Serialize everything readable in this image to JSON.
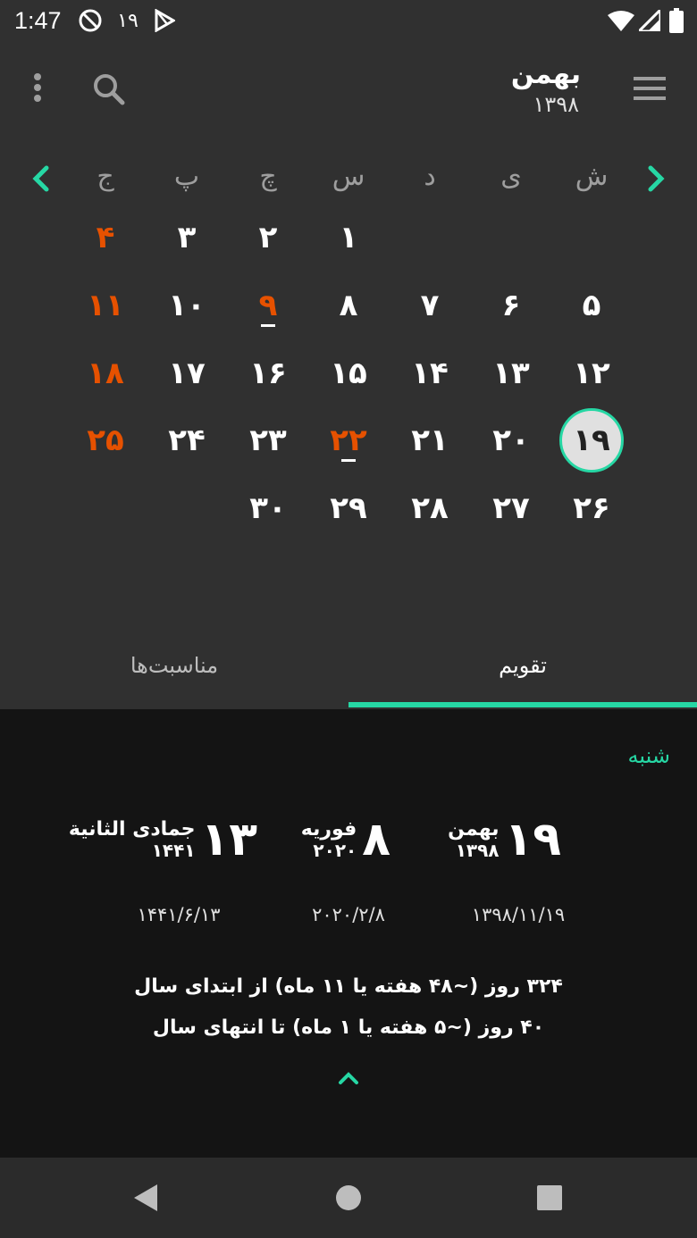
{
  "status_bar": {
    "time": "1:47",
    "day_badge": "۱۹",
    "icons": [
      "do-not-disturb-icon",
      "play-store-icon",
      "wifi-icon",
      "signal-icon",
      "battery-icon"
    ]
  },
  "app_bar": {
    "month": "بهمن",
    "year": "۱۳۹۸",
    "icons": [
      "menu-icon",
      "search-icon",
      "more-vert-icon"
    ]
  },
  "calendar": {
    "weekdays": [
      "ش",
      "ی",
      "د",
      "س",
      "چ",
      "پ",
      "ج"
    ],
    "weeks": [
      [
        "",
        "",
        "",
        "۱",
        "۲",
        "۳",
        "۴"
      ],
      [
        "۵",
        "۶",
        "۷",
        "۸",
        "۹",
        "۱۰",
        "۱۱"
      ],
      [
        "۱۲",
        "۱۳",
        "۱۴",
        "۱۵",
        "۱۶",
        "۱۷",
        "۱۸"
      ],
      [
        "۱۹",
        "۲۰",
        "۲۱",
        "۲۲",
        "۲۳",
        "۲۴",
        "۲۵"
      ],
      [
        "۲۶",
        "۲۷",
        "۲۸",
        "۲۹",
        "۳۰",
        "",
        ""
      ]
    ],
    "today": "۱۹",
    "colors": {
      "holiday": "#e65100",
      "accent": "#26d7a4",
      "today_bg": "#e0e0e0"
    }
  },
  "tabs": [
    {
      "label": "تقویم",
      "active": true
    },
    {
      "label": "مناسبت‌ها",
      "active": false
    }
  ],
  "details": {
    "weekday_name": "شنبه",
    "persian": {
      "day": "۱۹",
      "month": "بهمن",
      "year": "۱۳۹۸",
      "full": "۱۳۹۸/۱۱/۱۹"
    },
    "gregorian": {
      "day": "۸",
      "month": "فوریه",
      "year": "۲۰۲۰",
      "full": "۲۰۲۰/۲/۸"
    },
    "islamic": {
      "day": "۱۳",
      "month": "جمادی الثانیة",
      "year": "۱۴۴۱",
      "full": "۱۴۴۱/۶/۱۳"
    },
    "since_start": "۳۲۴ روز (~۴۸ هفته یا ۱۱ ماه) از ابتدای سال",
    "until_end": "۴۰ روز (~۵ هفته یا ۱ ماه) تا انتهای سال"
  },
  "nav_bar": [
    "back-icon",
    "home-icon",
    "recents-icon"
  ]
}
